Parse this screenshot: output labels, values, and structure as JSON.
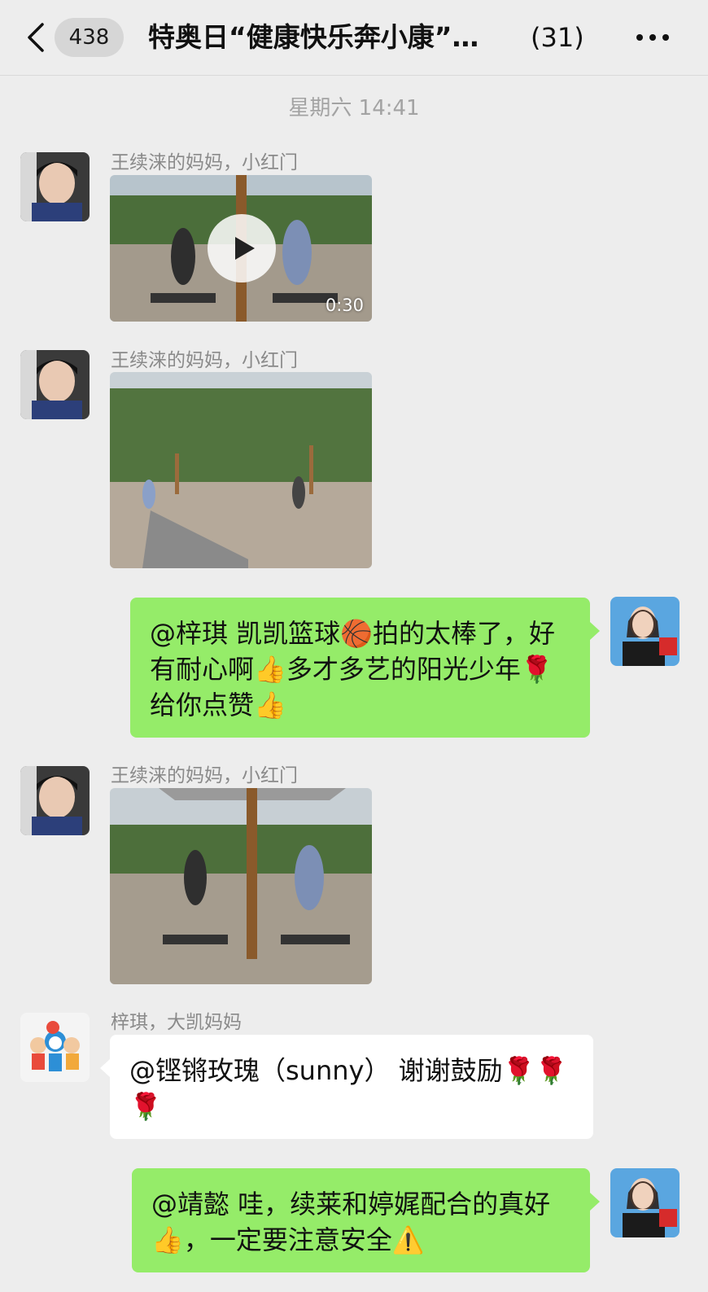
{
  "header": {
    "unread_count": "438",
    "title": "特奥日“健康快乐奔小康”…",
    "member_count": "(31)"
  },
  "timestamp": "星期六 14:41",
  "messages": [
    {
      "sender": "王续涞的妈妈，小红门",
      "type": "video",
      "duration": "0:30"
    },
    {
      "sender": "王续涞的妈妈，小红门",
      "type": "image"
    },
    {
      "type": "text",
      "direction": "outgoing",
      "text": "@梓琪 凯凯篮球🏀拍的太棒了，好有耐心啊👍多才多艺的阳光少年🌹给你点赞👍"
    },
    {
      "sender": "王续涞的妈妈，小红门",
      "type": "image"
    },
    {
      "sender": "梓琪，大凯妈妈",
      "type": "text",
      "direction": "incoming",
      "text": "@铿锵玫瑰（sunny） 谢谢鼓励🌹🌹 🌹"
    },
    {
      "type": "text",
      "direction": "outgoing",
      "text": "@靖懿 哇，续莱和婷娓配合的真好👍，一定要注意安全⚠️"
    }
  ],
  "colors": {
    "background": "#ededed",
    "outgoing_bubble": "#95ec69",
    "incoming_bubble": "#ffffff"
  },
  "icons": [
    "back-icon",
    "more-icon",
    "play-icon"
  ]
}
